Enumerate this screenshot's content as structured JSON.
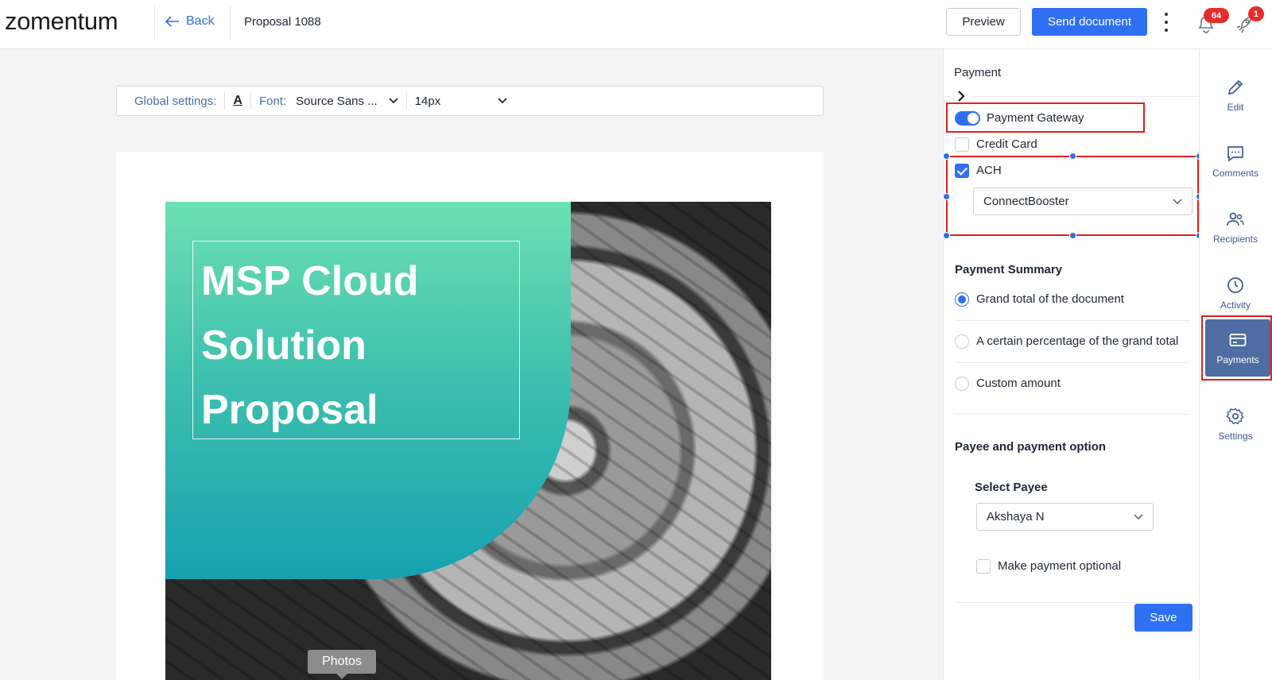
{
  "app": {
    "logo_text": "zomentum"
  },
  "header": {
    "back_label": "Back",
    "document_title": "Proposal 1088",
    "preview_label": "Preview",
    "send_label": "Send document",
    "notifications_count": "64",
    "rocket_count": "1"
  },
  "toolbar": {
    "global_label": "Global settings:",
    "font_label": "Font:",
    "font_value": "Source Sans ...",
    "size_value": "14px"
  },
  "cover": {
    "title_lines": [
      "MSP Cloud",
      "Solution",
      "Proposal"
    ],
    "photos_tooltip": "Photos"
  },
  "panel": {
    "title": "Payment",
    "gateway_label": "Payment Gateway",
    "gateway_enabled": true,
    "credit_card_label": "Credit Card",
    "credit_card_checked": false,
    "ach_label": "ACH",
    "ach_checked": true,
    "ach_provider": "ConnectBooster",
    "summary": {
      "heading": "Payment Summary",
      "options": [
        "Grand total of the document",
        "A certain percentage of the grand total",
        "Custom amount"
      ],
      "selected_index": 0
    },
    "payee": {
      "heading": "Payee and payment option",
      "select_label": "Select Payee",
      "selected": "Akshaya N",
      "optional_label": "Make payment optional",
      "optional_checked": false
    },
    "save_label": "Save"
  },
  "rail": {
    "items": [
      {
        "label": "Edit",
        "icon": "pencil-icon"
      },
      {
        "label": "Comments",
        "icon": "comment-icon"
      },
      {
        "label": "Recipients",
        "icon": "users-icon"
      },
      {
        "label": "Activity",
        "icon": "clock-icon"
      },
      {
        "label": "Payments",
        "icon": "credit-card-icon",
        "active": true
      },
      {
        "label": "Settings",
        "icon": "gear-icon"
      }
    ]
  },
  "colors": {
    "accent": "#2f6ff2",
    "highlight": "#e0211d",
    "rail_active": "#4e6da3",
    "teal_top": "#6de0b3",
    "teal_bottom": "#16a1b0"
  }
}
